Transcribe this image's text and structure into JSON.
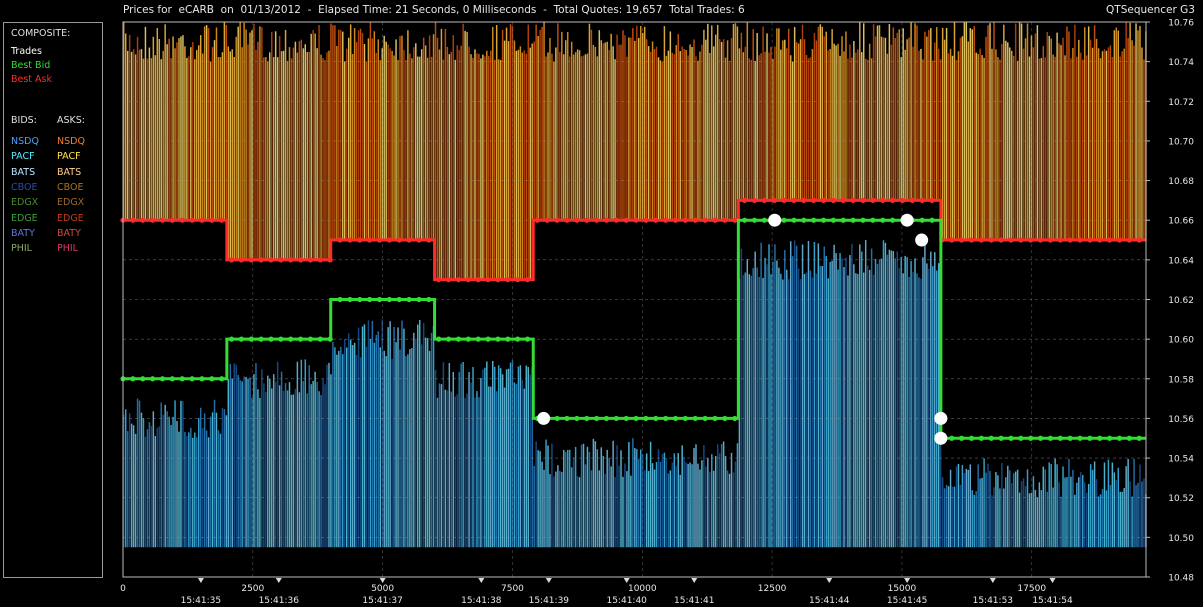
{
  "header": {
    "title": "Prices for  eCARB  on  01/13/2012  -  Elapsed Time: 21 Seconds, 0 Milliseconds  -  Total Quotes: 19,657  Total Trades: 6",
    "app_name": "QTSequencer G3"
  },
  "legend": {
    "composite_heading": "COMPOSITE:",
    "composite": [
      {
        "label": "Trades",
        "color": "#ffffff"
      },
      {
        "label": "Best Bid",
        "color": "#33dd33"
      },
      {
        "label": "Best Ask",
        "color": "#ff2a2a"
      }
    ],
    "bids_heading": "BIDS:",
    "asks_heading": "ASKS:",
    "exchanges": [
      {
        "bid": "NSDQ",
        "ask": "NSDQ",
        "bid_color": "#4aa0ff",
        "ask_color": "#ff7a2a"
      },
      {
        "bid": "PACF",
        "ask": "PACF",
        "bid_color": "#55e8ff",
        "ask_color": "#ffe04a"
      },
      {
        "bid": "BATS",
        "ask": "BATS",
        "bid_color": "#bfe8ff",
        "ask_color": "#ffd090"
      },
      {
        "bid": "CBOE",
        "ask": "CBOE",
        "bid_color": "#2a4aa8",
        "ask_color": "#b0701a"
      },
      {
        "bid": "EDGX",
        "ask": "EDGX",
        "bid_color": "#4a8a2a",
        "ask_color": "#9a6a2a"
      },
      {
        "bid": "EDGE",
        "ask": "EDGE",
        "bid_color": "#3aa03a",
        "ask_color": "#c03a1a"
      },
      {
        "bid": "BATY",
        "ask": "BATY",
        "bid_color": "#5a7ad8",
        "ask_color": "#d04a3a"
      },
      {
        "bid": "PHIL",
        "ask": "PHIL",
        "bid_color": "#8aa86a",
        "ask_color": "#d03a6a"
      }
    ]
  },
  "chart_data": {
    "type": "line",
    "ylim": [
      10.48,
      10.76
    ],
    "xlim": [
      0,
      19700
    ],
    "y_ticks": [
      "10.48",
      "10.50",
      "10.52",
      "10.54",
      "10.56",
      "10.58",
      "10.60",
      "10.62",
      "10.64",
      "10.66",
      "10.68",
      "10.70",
      "10.72",
      "10.74",
      "10.76"
    ],
    "x_ticks": [
      "0",
      "2500",
      "5000",
      "7500",
      "10000",
      "12500",
      "15000",
      "17500"
    ],
    "time_ticks": [
      {
        "x": 1500,
        "label": "15:41:35"
      },
      {
        "x": 3000,
        "label": "15:41:36"
      },
      {
        "x": 5000,
        "label": "15:41:37"
      },
      {
        "x": 6900,
        "label": "15:41:38"
      },
      {
        "x": 8200,
        "label": "15:41:39"
      },
      {
        "x": 9700,
        "label": "15:41:40"
      },
      {
        "x": 11000,
        "label": "15:41:41"
      },
      {
        "x": 13600,
        "label": "15:41:44"
      },
      {
        "x": 15100,
        "label": "15:41:45"
      },
      {
        "x": 16750,
        "label": "15:41:53"
      },
      {
        "x": 17900,
        "label": "15:41:54"
      }
    ],
    "grid": true,
    "series": [
      {
        "name": "Trades",
        "color": "#ffffff",
        "points": [
          {
            "x": 8100,
            "y": 10.56
          },
          {
            "x": 12550,
            "y": 10.66
          },
          {
            "x": 15100,
            "y": 10.66
          },
          {
            "x": 15380,
            "y": 10.65
          },
          {
            "x": 15750,
            "y": 10.56
          },
          {
            "x": 15750,
            "y": 10.55
          }
        ]
      },
      {
        "name": "Best Bid",
        "color": "#33dd33",
        "steps": [
          {
            "x": 0,
            "y": 10.58
          },
          {
            "x": 2000,
            "y": 10.6
          },
          {
            "x": 4000,
            "y": 10.62
          },
          {
            "x": 6000,
            "y": 10.6
          },
          {
            "x": 7900,
            "y": 10.56
          },
          {
            "x": 11800,
            "y": 10.56
          },
          {
            "x": 11850,
            "y": 10.66
          },
          {
            "x": 15700,
            "y": 10.66
          },
          {
            "x": 15750,
            "y": 10.55
          },
          {
            "x": 19700,
            "y": 10.55
          }
        ]
      },
      {
        "name": "Best Ask",
        "color": "#ff2a2a",
        "steps": [
          {
            "x": 0,
            "y": 10.66
          },
          {
            "x": 2000,
            "y": 10.64
          },
          {
            "x": 4000,
            "y": 10.65
          },
          {
            "x": 6000,
            "y": 10.63
          },
          {
            "x": 7900,
            "y": 10.66
          },
          {
            "x": 11800,
            "y": 10.66
          },
          {
            "x": 11850,
            "y": 10.67
          },
          {
            "x": 15700,
            "y": 10.67
          },
          {
            "x": 15750,
            "y": 10.65
          },
          {
            "x": 19700,
            "y": 10.65
          }
        ]
      }
    ]
  }
}
